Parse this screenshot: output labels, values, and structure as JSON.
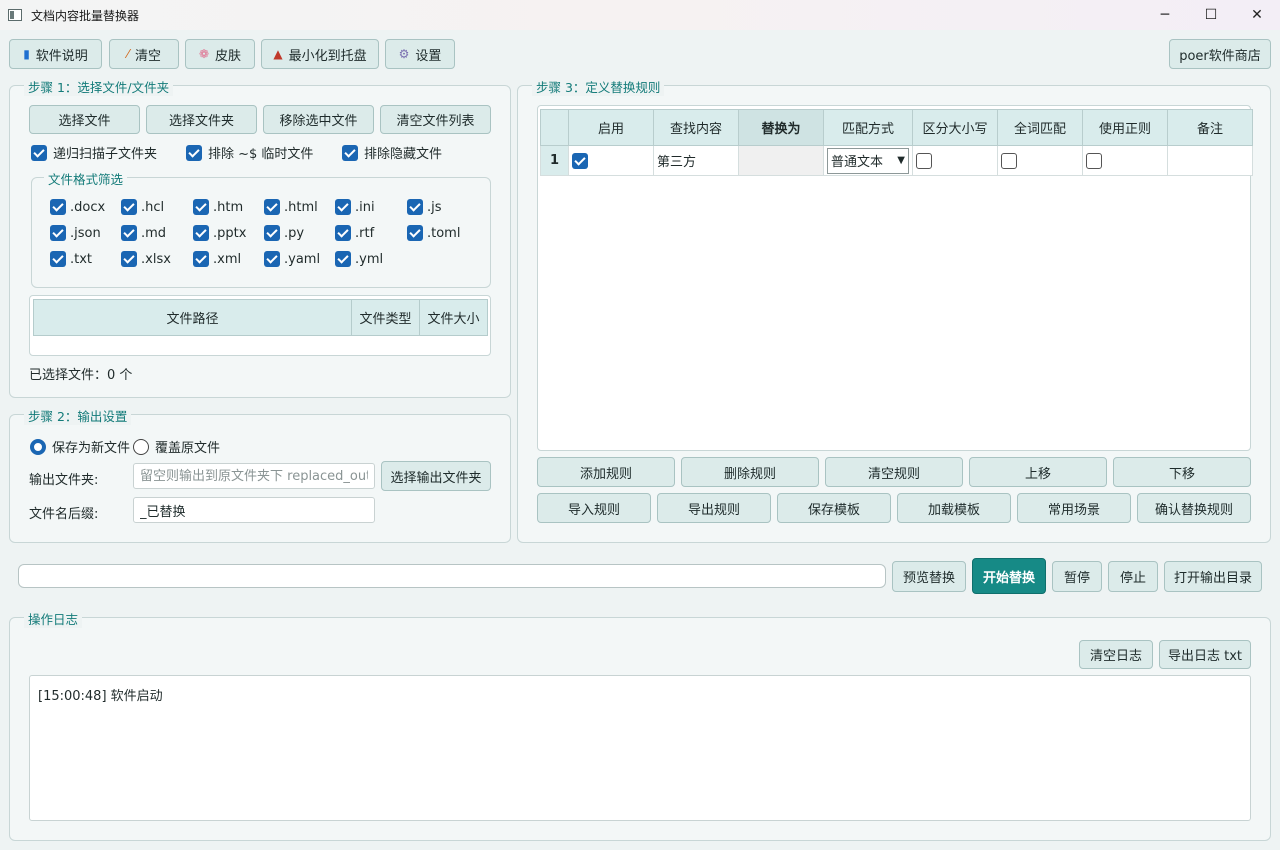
{
  "window": {
    "title": "文档内容批量替换器",
    "controls": [
      "─",
      "☐",
      "✕"
    ]
  },
  "toolbar": {
    "about": "软件说明",
    "clear": "清空",
    "skin": "皮肤",
    "minimize_tray": "最小化到托盘",
    "settings": "设置",
    "store": "poer软件商店"
  },
  "step1": {
    "title": "步骤 1：选择文件/文件夹",
    "buttons": {
      "select_file": "选择文件",
      "select_folder": "选择文件夹",
      "remove_selected": "移除选中文件",
      "clear_list": "清空文件列表"
    },
    "options": {
      "recursive": "递归扫描子文件夹",
      "exclude_temp": "排除 ~$ 临时文件",
      "exclude_hidden": "排除隐藏文件"
    },
    "format_title": "文件格式筛选",
    "formats": [
      ".docx",
      ".hcl",
      ".htm",
      ".html",
      ".ini",
      ".js",
      ".json",
      ".md",
      ".pptx",
      ".py",
      ".rtf",
      ".toml",
      ".txt",
      ".xlsx",
      ".xml",
      ".yaml",
      ".yml"
    ],
    "table_headers": {
      "path": "文件路径",
      "type": "文件类型",
      "size": "文件大小"
    },
    "selected_count": "已选择文件：0 个"
  },
  "step2": {
    "title": "步骤 2：输出设置",
    "save_new": "保存为新文件",
    "overwrite": "覆盖原文件",
    "output_folder_label": "输出文件夹:",
    "output_folder_placeholder": "留空则输出到原文件夹下 replaced_output",
    "choose_output": "选择输出文件夹",
    "suffix_label": "文件名后缀:",
    "suffix_value": "_已替换"
  },
  "step3": {
    "title": "步骤 3：定义替换规则",
    "headers": {
      "enable": "启用",
      "find": "查找内容",
      "replace": "替换为",
      "match": "匹配方式",
      "case": "区分大小写",
      "whole": "全词匹配",
      "regex": "使用正则",
      "note": "备注"
    },
    "row": {
      "num": "1",
      "find": "第三方",
      "match": "普通文本"
    },
    "buttons_row1": {
      "add": "添加规则",
      "delete": "删除规则",
      "clear": "清空规则",
      "up": "上移",
      "down": "下移"
    },
    "buttons_row2": {
      "import": "导入规则",
      "export": "导出规则",
      "save_tpl": "保存模板",
      "load_tpl": "加载模板",
      "scenarios": "常用场景",
      "confirm": "确认替换规则"
    }
  },
  "actions": {
    "preview": "预览替换",
    "start": "开始替换",
    "pause": "暂停",
    "stop": "停止",
    "open_output": "打开输出目录"
  },
  "log": {
    "title": "操作日志",
    "clear": "清空日志",
    "export": "导出日志 txt",
    "entries": [
      "[15:00:48] 软件启动"
    ]
  }
}
